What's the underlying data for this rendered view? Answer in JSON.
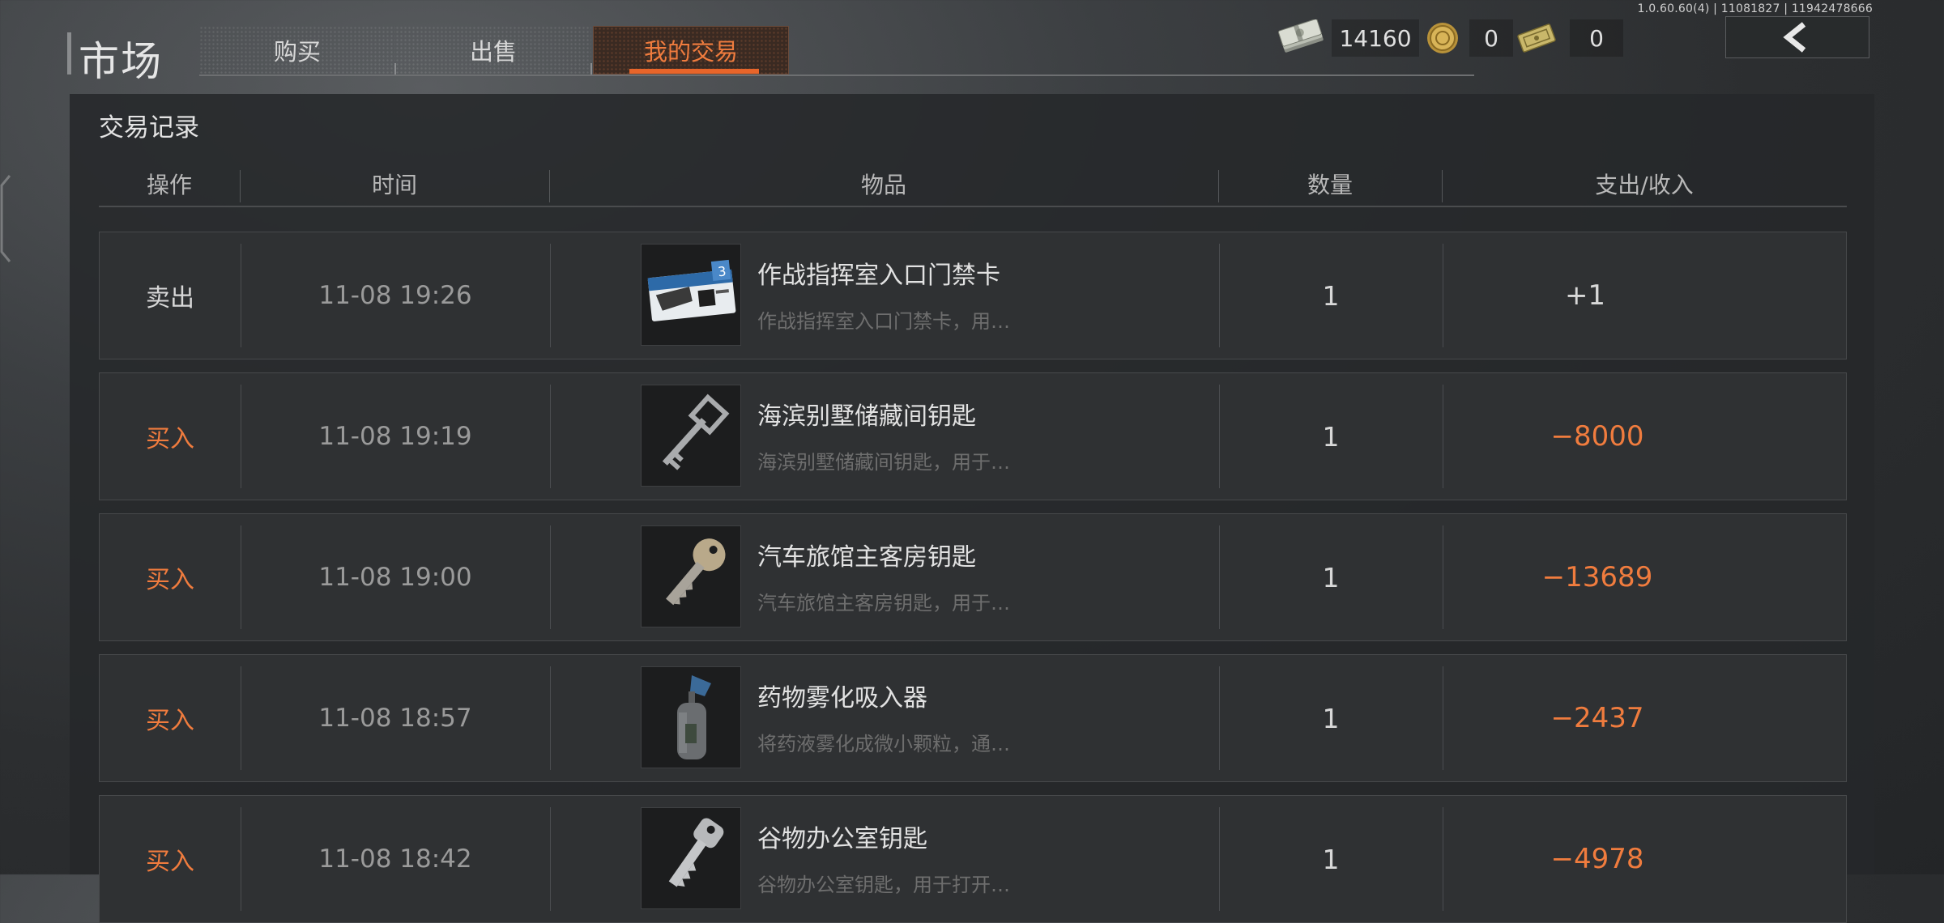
{
  "version": "1.0.60.60(4) | 11081827 | 11942478666",
  "header": {
    "title": "市场",
    "tabs": [
      {
        "label": "购买",
        "active": false
      },
      {
        "label": "出售",
        "active": false
      },
      {
        "label": "我的交易",
        "active": true
      }
    ]
  },
  "currencies": [
    {
      "icon": "cash-bundle-icon",
      "value": "14160"
    },
    {
      "icon": "gold-coin-icon",
      "value": "0"
    },
    {
      "icon": "voucher-ticket-icon",
      "value": "0"
    }
  ],
  "back_button": {
    "icon": "chevron-left-icon"
  },
  "panel": {
    "title": "交易记录",
    "columns": [
      "操作",
      "时间",
      "物品",
      "数量",
      "支出/收入"
    ]
  },
  "records": [
    {
      "op": "卖出",
      "type": "sell",
      "time": "11-08 19:26",
      "item": "作战指挥室入口门禁卡",
      "desc": "作战指挥室入口门禁卡，用…",
      "icon": "access-card-icon",
      "qty": "1",
      "amount": "+1"
    },
    {
      "op": "买入",
      "type": "buy",
      "time": "11-08 19:19",
      "item": "海滨别墅储藏间钥匙",
      "desc": "海滨别墅储藏间钥匙，用于…",
      "icon": "skeleton-key-icon",
      "qty": "1",
      "amount": "−8000"
    },
    {
      "op": "买入",
      "type": "buy",
      "time": "11-08 19:00",
      "item": "汽车旅馆主客房钥匙",
      "desc": "汽车旅馆主客房钥匙，用于…",
      "icon": "brass-key-icon",
      "qty": "1",
      "amount": "−13689"
    },
    {
      "op": "买入",
      "type": "buy",
      "time": "11-08 18:57",
      "item": "药物雾化吸入器",
      "desc": "将药液雾化成微小颗粒，通…",
      "icon": "nebulizer-icon",
      "qty": "1",
      "amount": "−2437"
    },
    {
      "op": "买入",
      "type": "buy",
      "time": "11-08 18:42",
      "item": "谷物办公室钥匙",
      "desc": "谷物办公室钥匙，用于打开…",
      "icon": "silver-key-icon",
      "qty": "1",
      "amount": "−4978"
    }
  ],
  "colors": {
    "accent": "#f07c3e",
    "accent_bar": "#e8652a",
    "row_bg": "#2f3133",
    "panel_bg": "#26282a"
  }
}
